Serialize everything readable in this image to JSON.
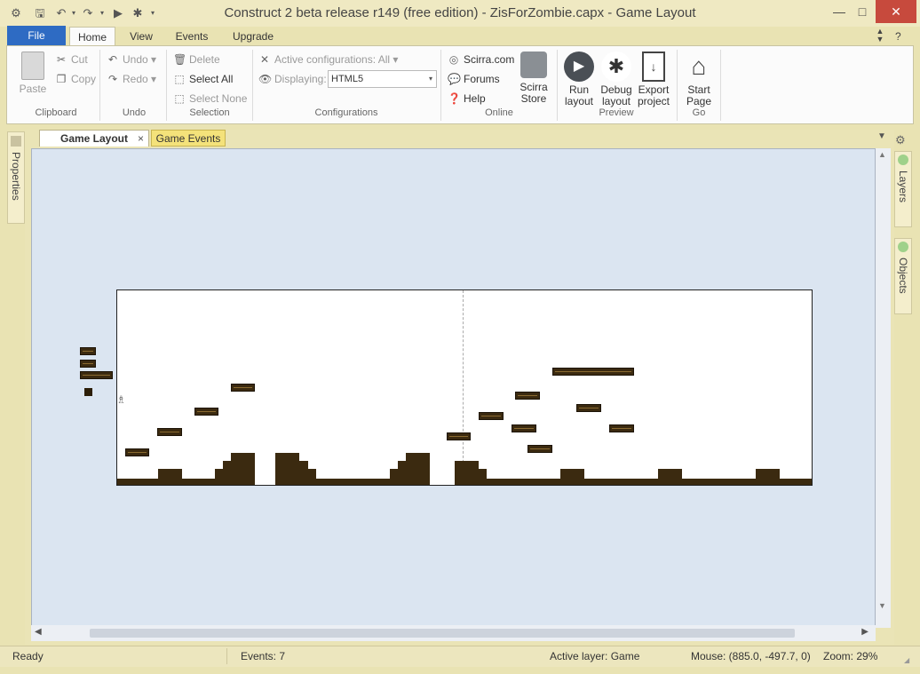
{
  "window": {
    "title": "Construct 2 beta release r149  (free edition) - ZisForZombie.capx - Game Layout",
    "minimize": "—",
    "maximize": "□",
    "close": "✕"
  },
  "ribbon": {
    "file_tab": "File",
    "tabs": [
      "Home",
      "View",
      "Events",
      "Upgrade"
    ],
    "clipboard": {
      "paste": "Paste",
      "cut": "Cut",
      "copy": "Copy",
      "label": "Clipboard"
    },
    "undo": {
      "undo": "Undo",
      "redo": "Redo",
      "label": "Undo"
    },
    "selection": {
      "delete": "Delete",
      "select_all": "Select All",
      "select_none": "Select None",
      "label": "Selection"
    },
    "configurations": {
      "active": "Active configurations: All",
      "displaying_label": "Displaying:",
      "displaying_value": "HTML5",
      "label": "Configurations"
    },
    "online": {
      "scirra": "Scirra.com",
      "forums": "Forums",
      "help": "Help",
      "store_line1": "Scirra",
      "store_line2": "Store",
      "label": "Online"
    },
    "preview": {
      "run1": "Run",
      "run2": "layout",
      "debug1": "Debug",
      "debug2": "layout",
      "export1": "Export",
      "export2": "project",
      "label": "Preview"
    },
    "go": {
      "start1": "Start",
      "start2": "Page",
      "label": "Go"
    }
  },
  "doc_tabs": [
    {
      "label": "Game Layout"
    },
    {
      "label": "Game Events"
    }
  ],
  "side_panels": {
    "properties": "Properties",
    "layers": "Layers",
    "objects": "Objects"
  },
  "status": {
    "state": "Ready",
    "events": "Events: 7",
    "active_layer": "Active layer: Game",
    "mouse": "Mouse: (885.0, -497.7, 0)",
    "zoom": "Zoom: 29%"
  },
  "colors": {
    "accent": "#2e6bc3",
    "chrome": "#e9e3b3",
    "canvas": "#dbe5f1",
    "tile": "#3b2a10"
  }
}
